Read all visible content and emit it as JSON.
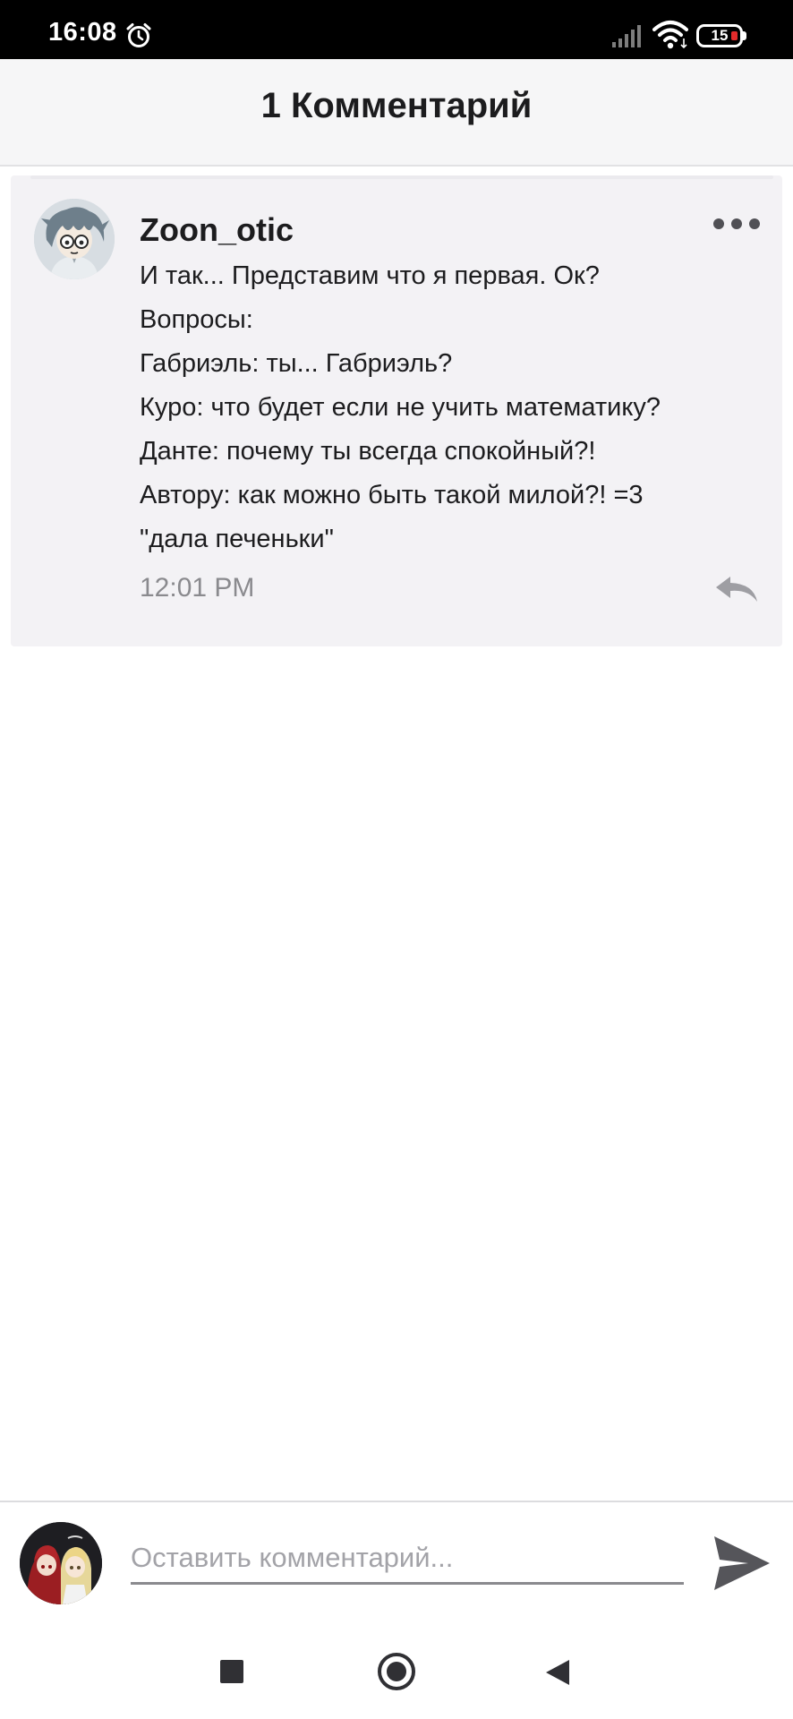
{
  "status_bar": {
    "time": "16:08",
    "battery_level": "15",
    "icons": [
      "alarm-icon",
      "signal-icon",
      "wifi-icon",
      "battery-icon"
    ]
  },
  "header": {
    "title": "1 Комментарий"
  },
  "comment": {
    "username": "Zoon_otic",
    "lines": [
      "И так... Представим что я первая. Ок?",
      "Вопросы:",
      "Габриэль: ты... Габриэль?",
      "Куро: что будет если не учить математику?",
      "Данте: почему ты всегда спокойный?!",
      "Автору: как можно быть такой милой?! =3",
      "\"дала печеньки\""
    ],
    "time": "12:01 PM",
    "icons": [
      "more-icon",
      "reply-icon"
    ]
  },
  "input_bar": {
    "placeholder": "Оставить комментарий...",
    "value": "",
    "icons": [
      "send-icon"
    ]
  },
  "nav_bar": {
    "icons": [
      "recent-apps-icon",
      "home-icon",
      "back-icon"
    ]
  },
  "colors": {
    "status_bar": "#000000",
    "header_bg": "#f6f6f7",
    "card_bg": "#f3f2f5",
    "text_primary": "#1c1c1e",
    "text_secondary": "#8a8a8e",
    "battery_low": "#e32b2b"
  }
}
